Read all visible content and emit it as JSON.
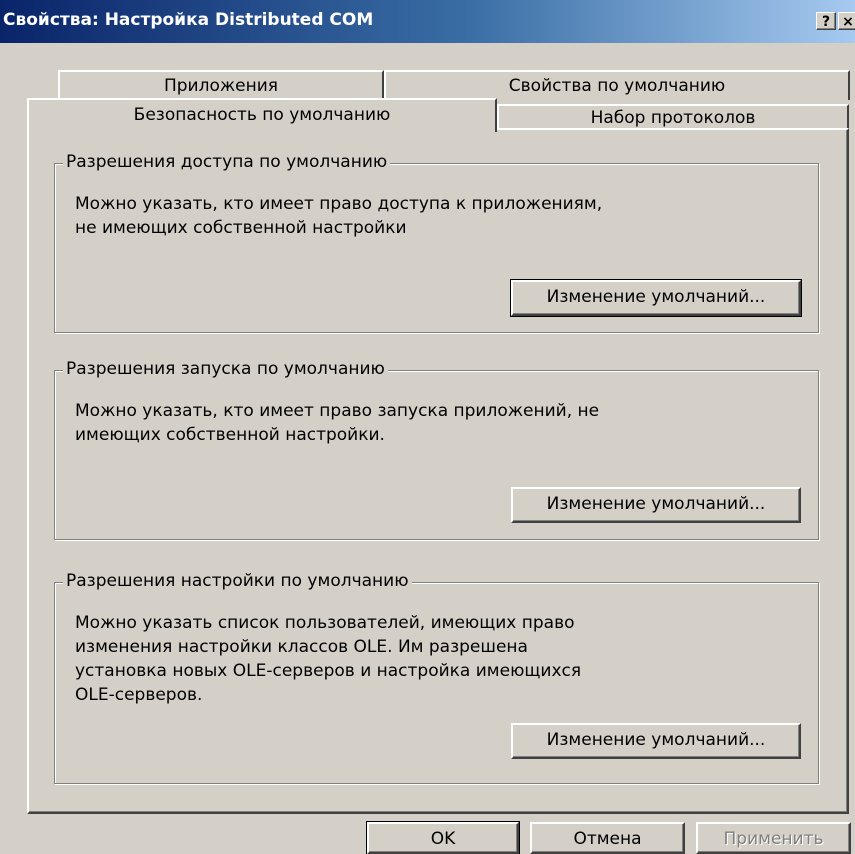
{
  "window": {
    "title": "Свойства: Настройка Distributed COM",
    "help_label": "?",
    "close_label": "×"
  },
  "tabs": {
    "back_row": [
      "Приложения",
      "Свойства по умолчанию"
    ],
    "front_row": [
      "Безопасность по умолчанию",
      "Набор протоколов"
    ],
    "active": "Безопасность по умолчанию"
  },
  "groups": [
    {
      "title": "Разрешения доступа по умолчанию",
      "lines": [
        "Можно указать, кто имеет право доступа к приложениям,",
        "не имеющих собственной настройки"
      ],
      "button": "Изменение умолчаний..."
    },
    {
      "title": "Разрешения запуска по умолчанию",
      "lines": [
        "Можно указать, кто имеет право запуска приложений, не",
        "имеющих собственной настройки."
      ],
      "button": "Изменение умолчаний..."
    },
    {
      "title": "Разрешения настройки по умолчанию",
      "lines": [
        "Можно указать список пользователей, имеющих право",
        "изменения настройки классов OLE. Им разрешена",
        "установка новых OLE-серверов и настройка имеющихся",
        "OLE-серверов."
      ],
      "button": "Изменение умолчаний..."
    }
  ],
  "footer": {
    "ok": "OK",
    "cancel": "Отмена",
    "apply": "Применить"
  }
}
